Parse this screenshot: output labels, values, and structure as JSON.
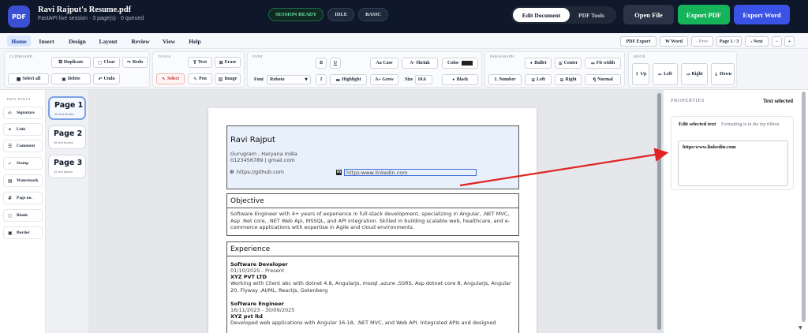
{
  "header": {
    "logo": "PDF",
    "title": "Ravi Rajput's Resume.pdf",
    "subtitle": "FastAPI live session · 3 page(s) · 0 queued",
    "status": [
      "SESSION READY",
      "IDLE",
      "BASIC"
    ],
    "modes": [
      "Edit Document",
      "PDF Tools"
    ],
    "open_label": "Open File",
    "export_pdf_label": "Export PDF",
    "export_word_label": "Export Word"
  },
  "tabs": [
    "Home",
    "Insert",
    "Design",
    "Layout",
    "Review",
    "View",
    "Help"
  ],
  "nav": {
    "pdf_export": "PDF Export",
    "word": "W Word",
    "prev": "‹ Prev",
    "page_indicator": "Page 1 / 3",
    "next": "› Next",
    "zoom_out": "−",
    "zoom_in": "+"
  },
  "toolbar": {
    "clipboard": {
      "label": "CLIPBOARD",
      "select_all": "Select all",
      "duplicate": "Duplicate",
      "clear": "Clear",
      "redo": "Redo",
      "delete": "Delete",
      "undo": "Undo"
    },
    "tools": {
      "label": "TOOLS",
      "text": "Text",
      "erase": "Erase",
      "select": "Select",
      "pen": "Pen",
      "image": "Image"
    },
    "font": {
      "label": "FONT",
      "bold": "B",
      "underline": "U",
      "case": "Aa Case",
      "shrink": "A- Shrink",
      "color": "Color",
      "font_label": "Font",
      "font_value": "Roboto",
      "italic": "I",
      "highlight": "Highlight",
      "grow": "A+ Grow",
      "size_label": "Size",
      "size_value": "10.6",
      "black": "Black"
    },
    "paragraph": {
      "label": "PARAGRAPH",
      "bullet": "Bullet",
      "center": "Center",
      "fit_width": "Fit width",
      "number": "1. Number",
      "left": "Left",
      "right": "Right",
      "normal": "Normal"
    },
    "move": {
      "label": "MOVE",
      "up": "Up",
      "left": "Left",
      "right": "Right",
      "down": "Down"
    }
  },
  "edit_tools": {
    "label": "EDIT TOOLS",
    "items": [
      "Signature",
      "Link",
      "Comment",
      "Stamp",
      "Watermark",
      "Page no.",
      "Blank",
      "Border"
    ]
  },
  "pages": [
    {
      "title": "Page 1",
      "sub": "26 text blocks"
    },
    {
      "title": "Page 2",
      "sub": "46 text blocks"
    },
    {
      "title": "Page 3",
      "sub": "11 text blocks"
    }
  ],
  "document": {
    "name": "Ravi Rajput",
    "location": "Gurugram , Haryana India",
    "contact": "0123456789 | gmail.com",
    "github": "https://github.com",
    "linkedin": "https:www.linkedin.com",
    "objective_title": "Objective",
    "objective_text": "Software Engineer with 4+ years of experience in full-stack development, specializing in Angular, .NET MVC, Asp .Net core, .NET Web Api, MSSQL, and API integration. Skilled in building scalable web, healthcare, and e-commerce applications with expertise in Agile and cloud environments.",
    "experience_title": "Experience",
    "jobs": [
      {
        "title": "Software Developer",
        "dates": "01/10/2025 - Present",
        "company": "XYZ PVT LTD",
        "desc": "Working with Client abc with dotnet 4.8, AngularJs, mssql ,azure ,SSRS, Asp dotnet core 8, AngularJs, Angular 20, Flyway ,AI/ML, ReactJs, Gotenberg"
      },
      {
        "title": "Software Engineer",
        "dates": "16/11/2023 - 30/09/2025",
        "company": "XYZ pvt ltd",
        "desc": "Developed web applications with Angular 16-18, .NET MVC, and Web API. Integrated APIs and designed"
      }
    ]
  },
  "properties": {
    "label": "PROPERTIES",
    "state": "Text selected",
    "edit_title": "Edit selected text",
    "hint": "Formatting is in the top ribbon",
    "value": "https:www.linkedin.com"
  },
  "colors": {
    "topbar": "#0f172a",
    "accent": "#3a52e6",
    "export_pdf": "#16b45a",
    "arrow": "#e02424"
  }
}
